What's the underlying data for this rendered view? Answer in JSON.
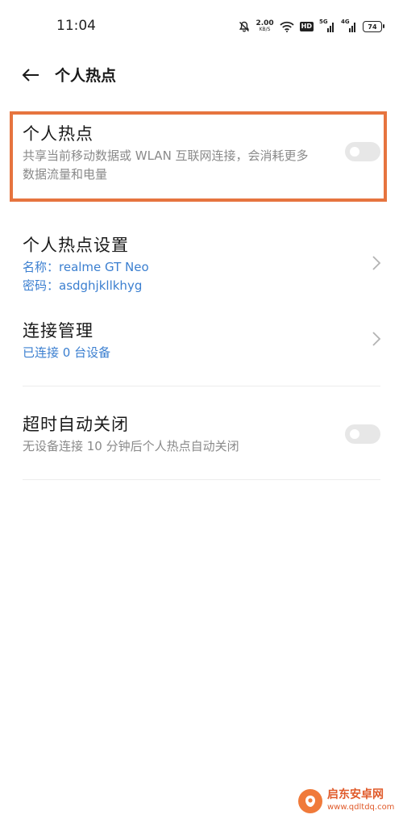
{
  "status_bar": {
    "time": "11:04",
    "net_speed_value": "2.00",
    "net_speed_unit": "KB/S",
    "hd_label": "HD",
    "sim1_tag": "5G",
    "sim2_tag": "4G",
    "battery_level": "74"
  },
  "header": {
    "title": "个人热点"
  },
  "hotspot": {
    "title": "个人热点",
    "description_line1": "共享当前移动数据或 WLAN 互联网连接，会消耗更多",
    "description_line2": "数据流量和电量",
    "enabled": false
  },
  "hotspot_settings": {
    "title": "个人热点设置",
    "name_line": "名称：realme GT Neo",
    "password_line": "密码：asdghjkllkhyg"
  },
  "connection_management": {
    "title": "连接管理",
    "status": "已连接 0 台设备"
  },
  "auto_off": {
    "title": "超时自动关闭",
    "description": "无设备连接 10 分钟后个人热点自动关闭",
    "enabled": false
  },
  "watermark": {
    "name": "启东安卓网",
    "url": "www.qdltdq.com"
  },
  "colors": {
    "highlight_border": "#e6743f",
    "link_blue": "#3b7fd0",
    "toggle_off": "#e7e7e7"
  }
}
